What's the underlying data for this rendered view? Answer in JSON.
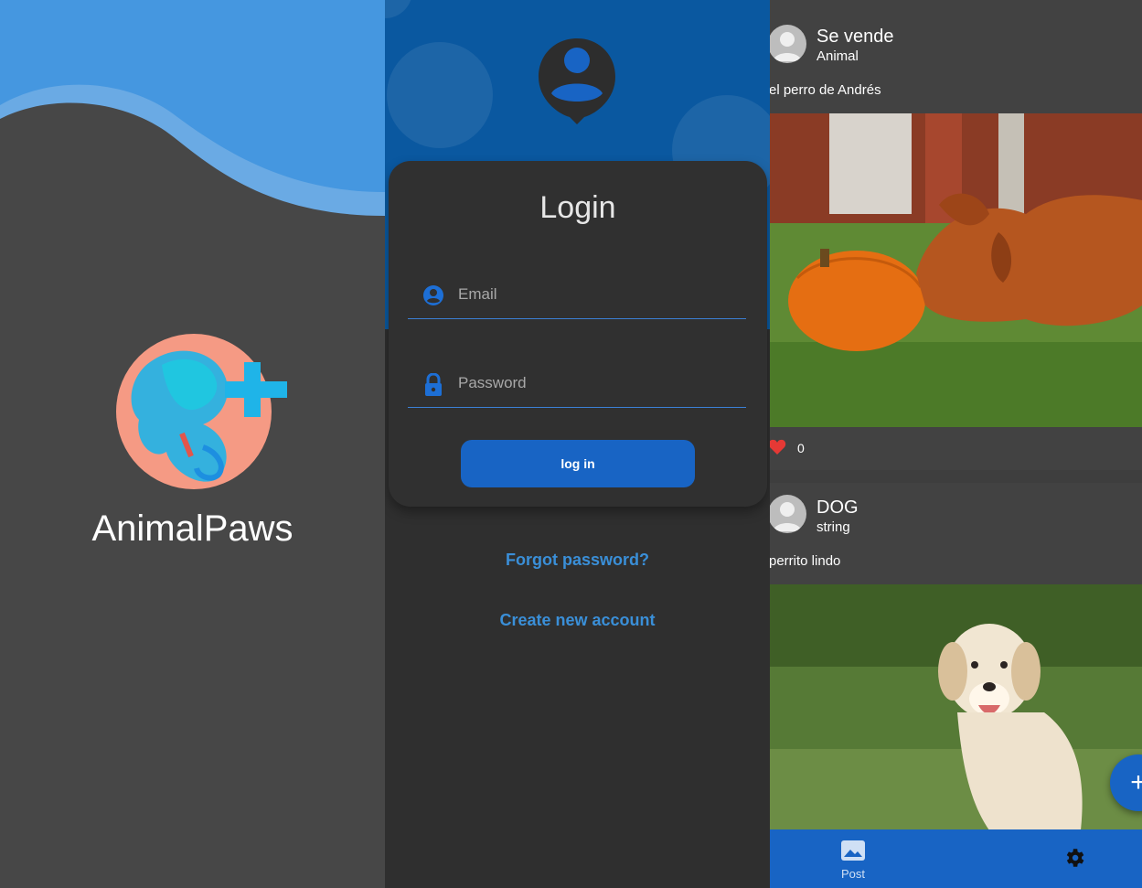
{
  "splash": {
    "app_name": "AnimalPaws"
  },
  "login": {
    "title": "Login",
    "email_placeholder": "Email",
    "password_placeholder": "Password",
    "login_button": "log in",
    "forgot_password": "Forgot password?",
    "create_account": "Create new account"
  },
  "feed": {
    "posts": [
      {
        "title": "Se vende",
        "subtitle": "Animal",
        "text": "el perro de Andrés",
        "likes": "0"
      },
      {
        "title": "DOG",
        "subtitle": "string",
        "text": "perrito lindo"
      }
    ],
    "fab_label": "+",
    "nav": {
      "post_label": "Post"
    }
  },
  "colors": {
    "accent": "#1864c4",
    "link": "#3a8fd8",
    "header": "#0a58a0"
  }
}
